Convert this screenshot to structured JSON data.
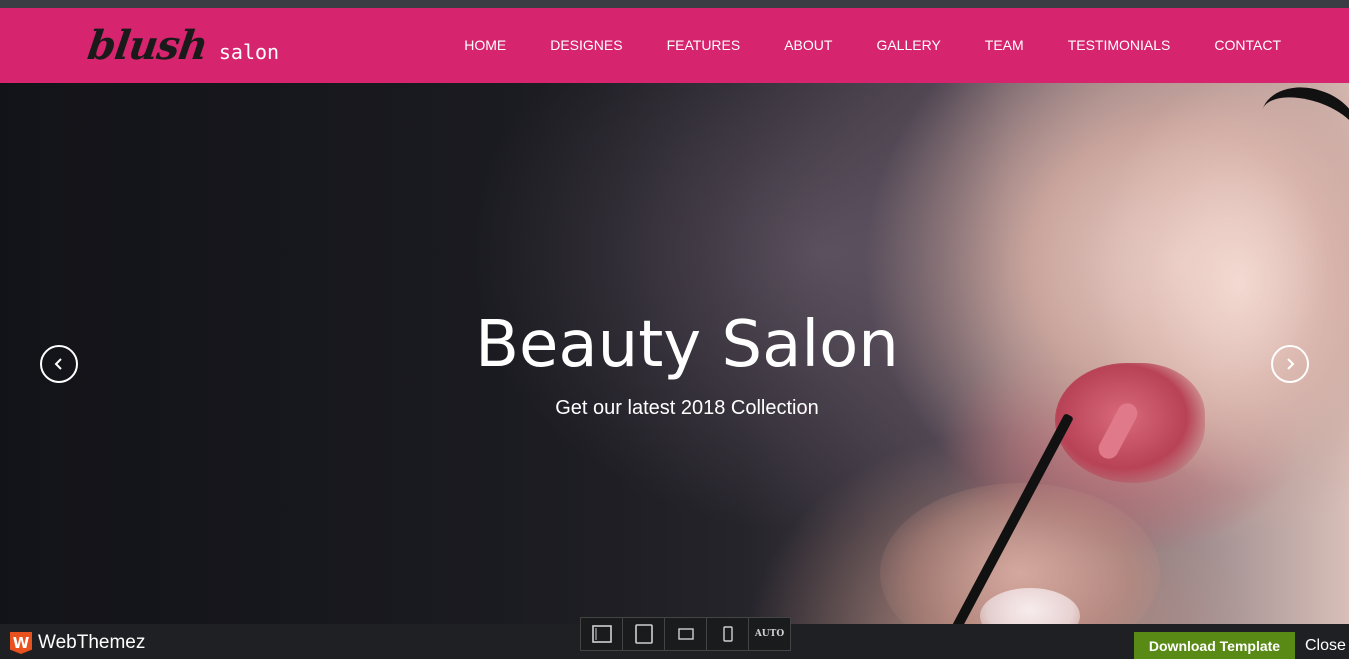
{
  "brand": {
    "script": "blush",
    "suffix": "salon"
  },
  "nav": {
    "items": [
      {
        "label": "HOME"
      },
      {
        "label": "DESIGNES"
      },
      {
        "label": "FEATURES"
      },
      {
        "label": "ABOUT"
      },
      {
        "label": "GALLERY"
      },
      {
        "label": "TEAM"
      },
      {
        "label": "TESTIMONIALS"
      },
      {
        "label": "CONTACT"
      }
    ]
  },
  "hero": {
    "title": "Beauty Salon",
    "subtitle": "Get our latest 2018 Collection",
    "prev_icon": "chevron-left-icon",
    "next_icon": "chevron-right-icon"
  },
  "bottom_bar": {
    "logo_badge": "W",
    "logo_text": "WebThemez",
    "devices": [
      {
        "icon": "desktop-icon"
      },
      {
        "icon": "tablet-portrait-icon"
      },
      {
        "icon": "tablet-landscape-icon"
      },
      {
        "icon": "phone-icon"
      },
      {
        "label": "AUTO"
      }
    ],
    "download_label": "Download Template",
    "close_label": "Close"
  },
  "colors": {
    "brand_pink": "#d6246e",
    "download_green": "#5a8a16",
    "footer_dark": "#1f2023"
  }
}
